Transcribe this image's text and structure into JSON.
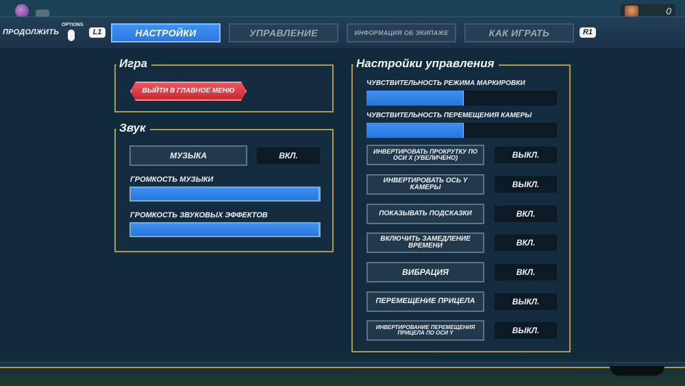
{
  "hud": {
    "score": "0"
  },
  "topbar": {
    "continue_label": "ПРОДОЛЖИТЬ",
    "options_label": "OPTIONS",
    "left_shoulder": "L1",
    "right_shoulder": "R1",
    "tabs": [
      {
        "label": "НАСТРОЙКИ",
        "active": true
      },
      {
        "label": "УПРАВЛЕНИЕ",
        "active": false
      },
      {
        "label": "ИНФОРМАЦИЯ ОБ ЭКИПАЖЕ",
        "active": false
      },
      {
        "label": "КАК ИГРАТЬ",
        "active": false
      }
    ]
  },
  "game_section": {
    "title": "Игра",
    "exit_button": "ВЫЙТИ В ГЛАВНОЕ МЕНЮ"
  },
  "sound_section": {
    "title": "Звук",
    "music_button": "МУЗЫКА",
    "music_value": "ВКЛ.",
    "music_volume_label": "ГРОМКОСТЬ МУЗЫКИ",
    "music_volume": 1.0,
    "sfx_volume_label": "ГРОМКОСТЬ ЗВУКОВЫХ ЭФФЕКТОВ",
    "sfx_volume": 1.0
  },
  "controls_section": {
    "title": "Настройки управления",
    "marking_sensitivity_label": "ЧУВСТВИТЕЛЬНОСТЬ РЕЖИМА МАРКИРОВКИ",
    "marking_sensitivity": 0.51,
    "camera_sensitivity_label": "ЧУВСТВИТЕЛЬНОСТЬ ПЕРЕМЕЩЕНИЯ КАМЕРЫ",
    "camera_sensitivity": 0.51,
    "toggles": [
      {
        "label": "ИНВЕРТИРОВАТЬ ПРОКРУТКУ ПО ОСИ X (УВЕЛИЧЕНО)",
        "value": "ВЫКЛ."
      },
      {
        "label": "ИНВЕРТИРОВАТЬ ОСЬ Y КАМЕРЫ",
        "value": "ВЫКЛ."
      },
      {
        "label": "ПОКАЗЫВАТЬ ПОДСКАЗКИ",
        "value": "ВКЛ."
      },
      {
        "label": "ВКЛЮЧИТЬ ЗАМЕДЛЕНИЕ ВРЕМЕНИ",
        "value": "ВКЛ."
      },
      {
        "label": "ВИБРАЦИЯ",
        "value": "ВКЛ."
      },
      {
        "label": "ПЕРЕМЕЩЕНИЕ ПРИЦЕЛА",
        "value": "ВЫКЛ."
      },
      {
        "label": "ИНВЕРТИРОВАНИЕ ПЕРЕМЕЩЕНИЯ ПРИЦЕЛА ПО ОСИ Y",
        "value": "ВЫКЛ."
      }
    ]
  },
  "colors": {
    "accent": "#2a78e0",
    "panel_border": "#b59a45",
    "danger": "#d8343c"
  }
}
